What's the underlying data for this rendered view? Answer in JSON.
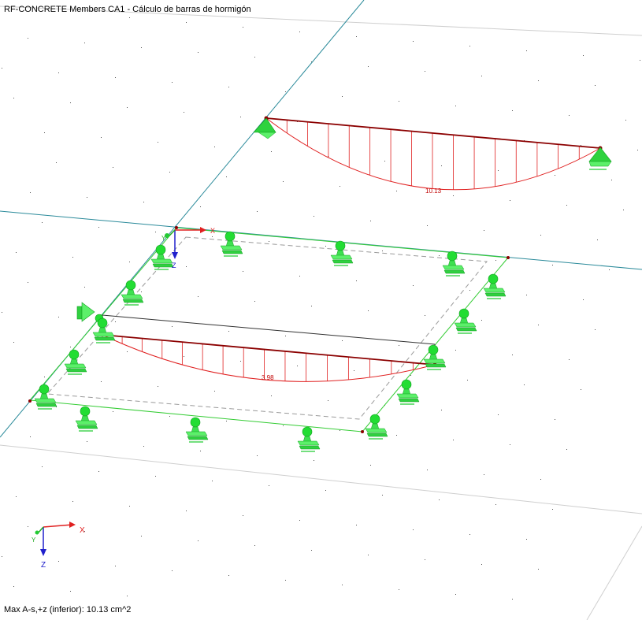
{
  "window": {
    "title": "RF-CONCRETE Members CA1 - Cálculo de barras de hormigón"
  },
  "results": {
    "top_member_max_label": "10.13",
    "lower_member_max_label": "3.98",
    "summary": "Max A-s,+z (inferior): 10.13 cm^2"
  },
  "axes": {
    "model_x": "X",
    "model_y": "Y",
    "model_z": "Z",
    "triad_x": "X",
    "triad_y": "Y",
    "triad_z": "Z"
  },
  "colors": {
    "background": "#ffffff",
    "result_diagram": "#e02020",
    "member": "#8b0000",
    "support": "#22cc33",
    "slab_edge": "#33cc33",
    "dashed_outline": "#9a9a9a",
    "axis_line": "#2a8a9a",
    "triad_x": "#e02020",
    "triad_y": "#22aa22",
    "triad_z": "#2020cc"
  },
  "icons": {
    "support_glyph": "nodal-support-icon",
    "hinge_glyph": "hinge-support-icon"
  }
}
